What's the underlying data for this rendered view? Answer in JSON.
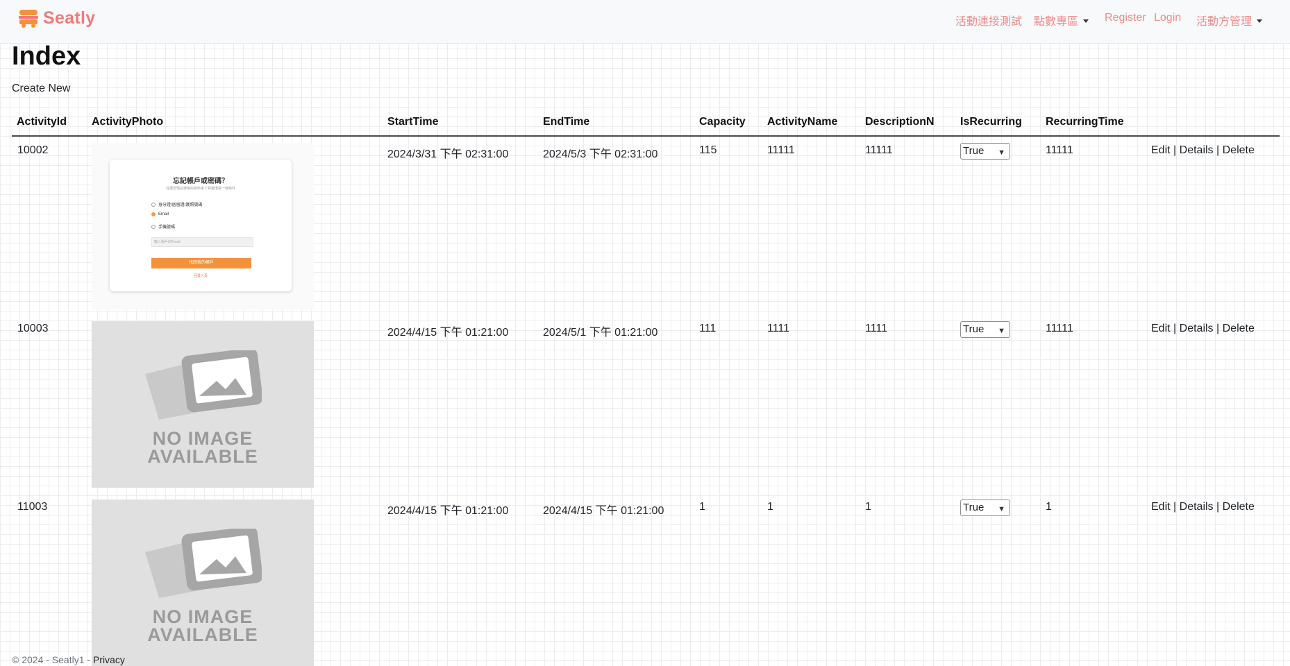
{
  "navbar": {
    "brand": "Seatly",
    "links": {
      "activity_test": "活動連接測試",
      "points_zone": "點數專區",
      "register": "Register",
      "login": "Login",
      "organizer_admin": "活動方管理"
    }
  },
  "page": {
    "title": "Index",
    "create_new": "Create New"
  },
  "table": {
    "headers": {
      "id": "ActivityId",
      "photo": "ActivityPhoto",
      "start": "StartTime",
      "end": "EndTime",
      "capacity": "Capacity",
      "name": "ActivityName",
      "desc": "DescriptionN",
      "recurring": "IsRecurring",
      "recurring_time": "RecurringTime"
    },
    "rows": [
      {
        "id": "10002",
        "start": "2024/3/31 下午 02:31:00",
        "end": "2024/5/3 下午 02:31:00",
        "capacity": "115",
        "name": "11111",
        "desc": "11111",
        "recurring": "True",
        "recurring_time": "11111",
        "photo": {
          "title": "忘記帳戶或密碼？",
          "subtitle": "任選您現在使用的資料來了歸還環境一條條件",
          "options": [
            "身分證/居留證/護照號碼",
            "Email",
            "手機號碼"
          ],
          "input_placeholder": "輸入帳戶的Email",
          "button": "找回我的帳戶",
          "link": "回登入頁"
        }
      },
      {
        "id": "10003",
        "start": "2024/4/15 下午 01:21:00",
        "end": "2024/5/1 下午 01:21:00",
        "capacity": "111",
        "name": "1111",
        "desc": "1111",
        "recurring": "True",
        "recurring_time": "11111",
        "photo_text": [
          "NO IMAGE",
          "AVAILABLE"
        ]
      },
      {
        "id": "11003",
        "start": "2024/4/15 下午 01:21:00",
        "end": "2024/4/15 下午 01:21:00",
        "capacity": "1",
        "name": "1",
        "desc": "1",
        "recurring": "True",
        "recurring_time": "1",
        "photo_text": [
          "NO IMAGE",
          "AVAILABLE"
        ]
      }
    ],
    "actions": {
      "edit": "Edit",
      "details": "Details",
      "delete": "Delete",
      "separator": "|"
    }
  },
  "footer": {
    "copyright": "© 2024 - Seatly1 -",
    "privacy": "Privacy"
  },
  "colors": {
    "brand": "#f07a7a",
    "nav_link": "#ee8a8a",
    "accent_orange": "#f5913a"
  }
}
